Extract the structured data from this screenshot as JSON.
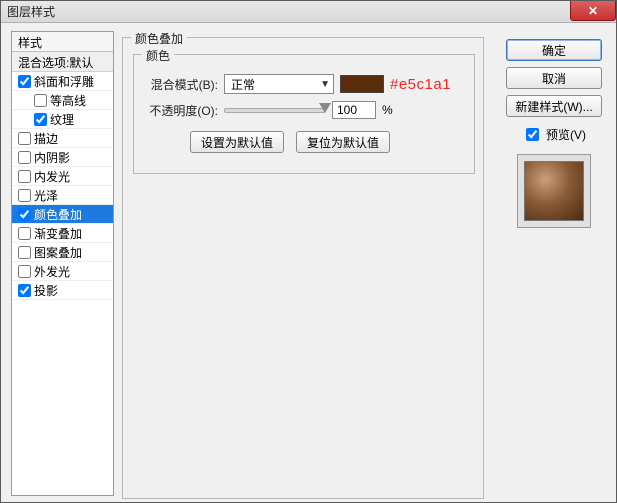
{
  "window": {
    "title": "图层样式"
  },
  "sidebar": {
    "header": "样式",
    "sub": "混合选项:默认",
    "items": [
      {
        "label": "斜面和浮雕",
        "checked": true,
        "indent": false,
        "selected": false
      },
      {
        "label": "等高线",
        "checked": false,
        "indent": true,
        "selected": false
      },
      {
        "label": "纹理",
        "checked": true,
        "indent": true,
        "selected": false
      },
      {
        "label": "描边",
        "checked": false,
        "indent": false,
        "selected": false
      },
      {
        "label": "内阴影",
        "checked": false,
        "indent": false,
        "selected": false
      },
      {
        "label": "内发光",
        "checked": false,
        "indent": false,
        "selected": false
      },
      {
        "label": "光泽",
        "checked": false,
        "indent": false,
        "selected": false
      },
      {
        "label": "颜色叠加",
        "checked": true,
        "indent": false,
        "selected": true
      },
      {
        "label": "渐变叠加",
        "checked": false,
        "indent": false,
        "selected": false
      },
      {
        "label": "图案叠加",
        "checked": false,
        "indent": false,
        "selected": false
      },
      {
        "label": "外发光",
        "checked": false,
        "indent": false,
        "selected": false
      },
      {
        "label": "投影",
        "checked": true,
        "indent": false,
        "selected": false
      }
    ]
  },
  "center": {
    "group_title": "颜色叠加",
    "inner_title": "颜色",
    "blend_label": "混合模式(B):",
    "blend_value": "正常",
    "swatch_color": "#5b2d0d",
    "annotation": "#e5c1a1",
    "opacity_label": "不透明度(O):",
    "opacity_value": "100",
    "opacity_suffix": "%",
    "set_default": "设置为默认值",
    "reset_default": "复位为默认值"
  },
  "right": {
    "ok": "确定",
    "cancel": "取消",
    "new_style": "新建样式(W)...",
    "preview_label": "预览(V)",
    "preview_checked": true
  }
}
